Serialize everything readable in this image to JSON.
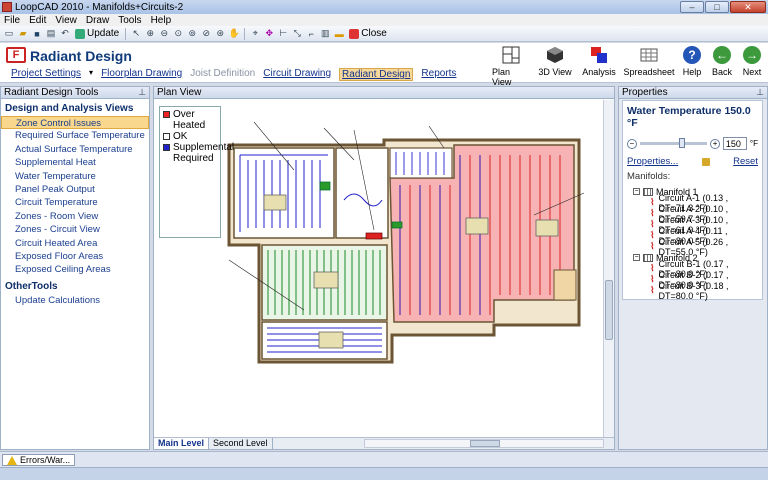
{
  "window": {
    "title": "LoopCAD 2010 - Manifolds+Circuits-2"
  },
  "menu": [
    "File",
    "Edit",
    "View",
    "Draw",
    "Tools",
    "Help"
  ],
  "toolbar": {
    "update_label": "Update",
    "close_label": "Close"
  },
  "ribbon": {
    "title": "Radiant Design",
    "logo_letter": "F",
    "links": [
      "Project Settings",
      "Floorplan Drawing",
      "Joist Definition",
      "Circuit Drawing",
      "Radiant Design",
      "Reports"
    ],
    "buttons": [
      "Plan View",
      "3D View",
      "Analysis",
      "Spreadsheet",
      "Help",
      "Back",
      "Next"
    ]
  },
  "left_panel": {
    "header": "Radiant Design Tools",
    "section1": "Design and Analysis Views",
    "items": [
      "Zone Control Issues",
      "Required Surface Temperature",
      "Actual Surface Temperature",
      "Supplemental Heat",
      "Water Temperature",
      "Panel Peak Output",
      "Circuit Temperature",
      "Zones - Room View",
      "Zones - Circuit View",
      "Circuit Heated Area",
      "Exposed Floor Areas",
      "Exposed Ceiling Areas"
    ],
    "section2": "OtherTools",
    "other_items": [
      "Update Calculations"
    ]
  },
  "center_panel": {
    "header": "Plan View",
    "legend": [
      "Over Heated",
      "OK",
      "Supplemental Required"
    ],
    "tabs": [
      "Main Level",
      "Second Level"
    ],
    "colors": {
      "over": "#f44",
      "ok": "#ffffff",
      "supp": "#22c"
    }
  },
  "right_panel": {
    "header": "Properties",
    "title": "Water Temperature 150.0 °F",
    "slider_value": "150",
    "unit": "°F",
    "slider_level_percent": 62,
    "properties_link": "Properties...",
    "reset_link": "Reset",
    "manifolds_label": "Manifolds:",
    "manifolds": [
      {
        "name": "Manifold 1",
        "circuits": [
          "Circuit A-1 (0.13 , DT=71.3 °F)",
          "Circuit A-2 (0.10 , DT=59.7 °F)",
          "Circuit A-3 (0.10 , DT=61.9 °F)",
          "Circuit A-4 (0.11 , DT=80.0 °F)",
          "Circuit A-5 (0.26 , DT=55.0 °F)"
        ]
      },
      {
        "name": "Manifold 2",
        "circuits": [
          "Circuit B-1 (0.17 , DT=80.0 °F)",
          "Circuit B-2 (0.17 , DT=80.0 °F)",
          "Circuit B-3 (0.18 , DT=80.0 °F)"
        ]
      }
    ]
  },
  "status": {
    "errors_tab": "Errors/War..."
  }
}
